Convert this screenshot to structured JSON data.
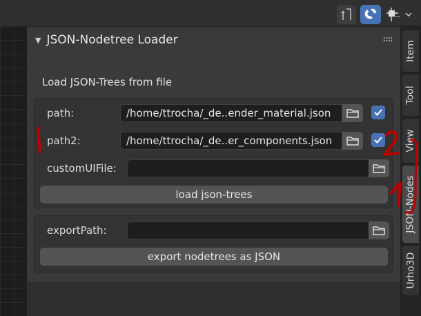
{
  "header": {
    "pin_icon": "pin-icon",
    "snap_icon": "magnet-snap-icon",
    "grid_icon": "grid-snap-icon"
  },
  "panel": {
    "title": "JSON-Nodetree Loader",
    "section_label": "Load JSON-Trees from file",
    "rows": {
      "path": {
        "label": "path:",
        "value": "/home/ttrocha/_de..ender_material.json",
        "checked": true
      },
      "path2": {
        "label": "path2:",
        "value": "/home/ttrocha/_de..er_components.json",
        "checked": true
      },
      "custom": {
        "label": "customUIFile:",
        "value": ""
      }
    },
    "load_button": "load json-trees",
    "export_path_label": "exportPath:",
    "export_path_value": "",
    "export_button": "export nodetrees as JSON"
  },
  "tabs": [
    {
      "label": "Item"
    },
    {
      "label": "Tool"
    },
    {
      "label": "View"
    },
    {
      "label": "JSON-Nodes",
      "active": true
    },
    {
      "label": "Urho3D"
    }
  ],
  "annotations": {
    "mark_1_left": "1",
    "mark_2": "2",
    "mark_1_right": "1"
  },
  "colors": {
    "accent": "#4772b3",
    "annotation": "#c00000"
  }
}
